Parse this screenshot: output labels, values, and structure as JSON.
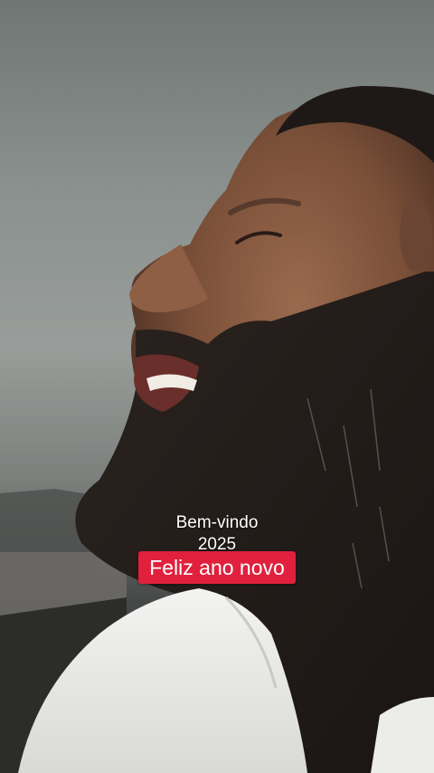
{
  "overlay": {
    "line1": "Bem-vindo",
    "line2": "2025",
    "caption": "Feliz ano novo",
    "caption_bg": "#e0203d",
    "text_color": "#ffffff"
  }
}
